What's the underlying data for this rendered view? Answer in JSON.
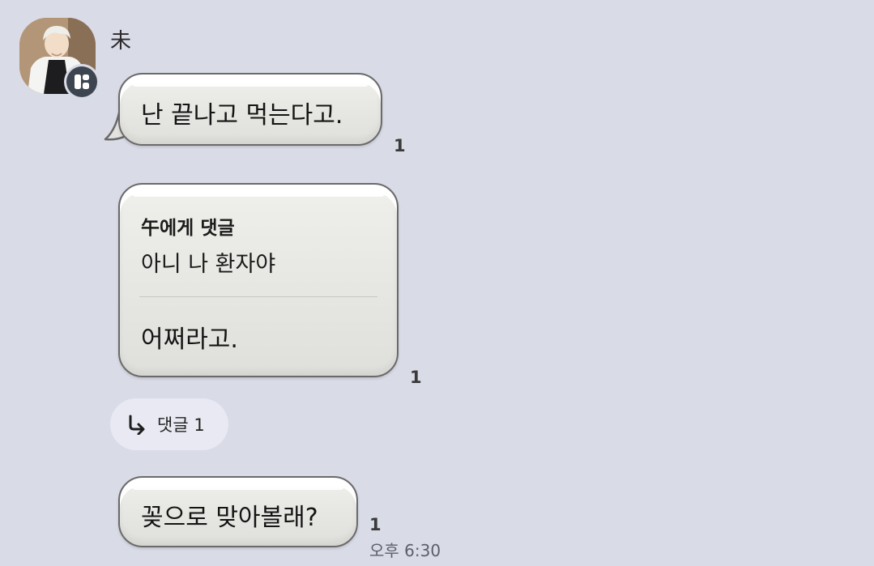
{
  "sender": {
    "name": "未"
  },
  "messages": [
    {
      "text": "난 끝나고 먹는다고.",
      "unread": "1"
    },
    {
      "reply": {
        "target": "午에게 댓글",
        "quote": "아니 나 환자야"
      },
      "text": "어쩌라고.",
      "unread": "1"
    },
    {
      "text": "꽂으로 맞아볼래?",
      "unread": "1",
      "time": "오후 6:30"
    }
  ],
  "thread": {
    "label": "댓글 1"
  },
  "colors": {
    "background": "#d9dbe7",
    "bubble": "#e6e6e2",
    "bubble_border": "#6a6a6a"
  },
  "icons": [
    "profile-avatar",
    "badge-icon",
    "reply-arrow-icon"
  ]
}
